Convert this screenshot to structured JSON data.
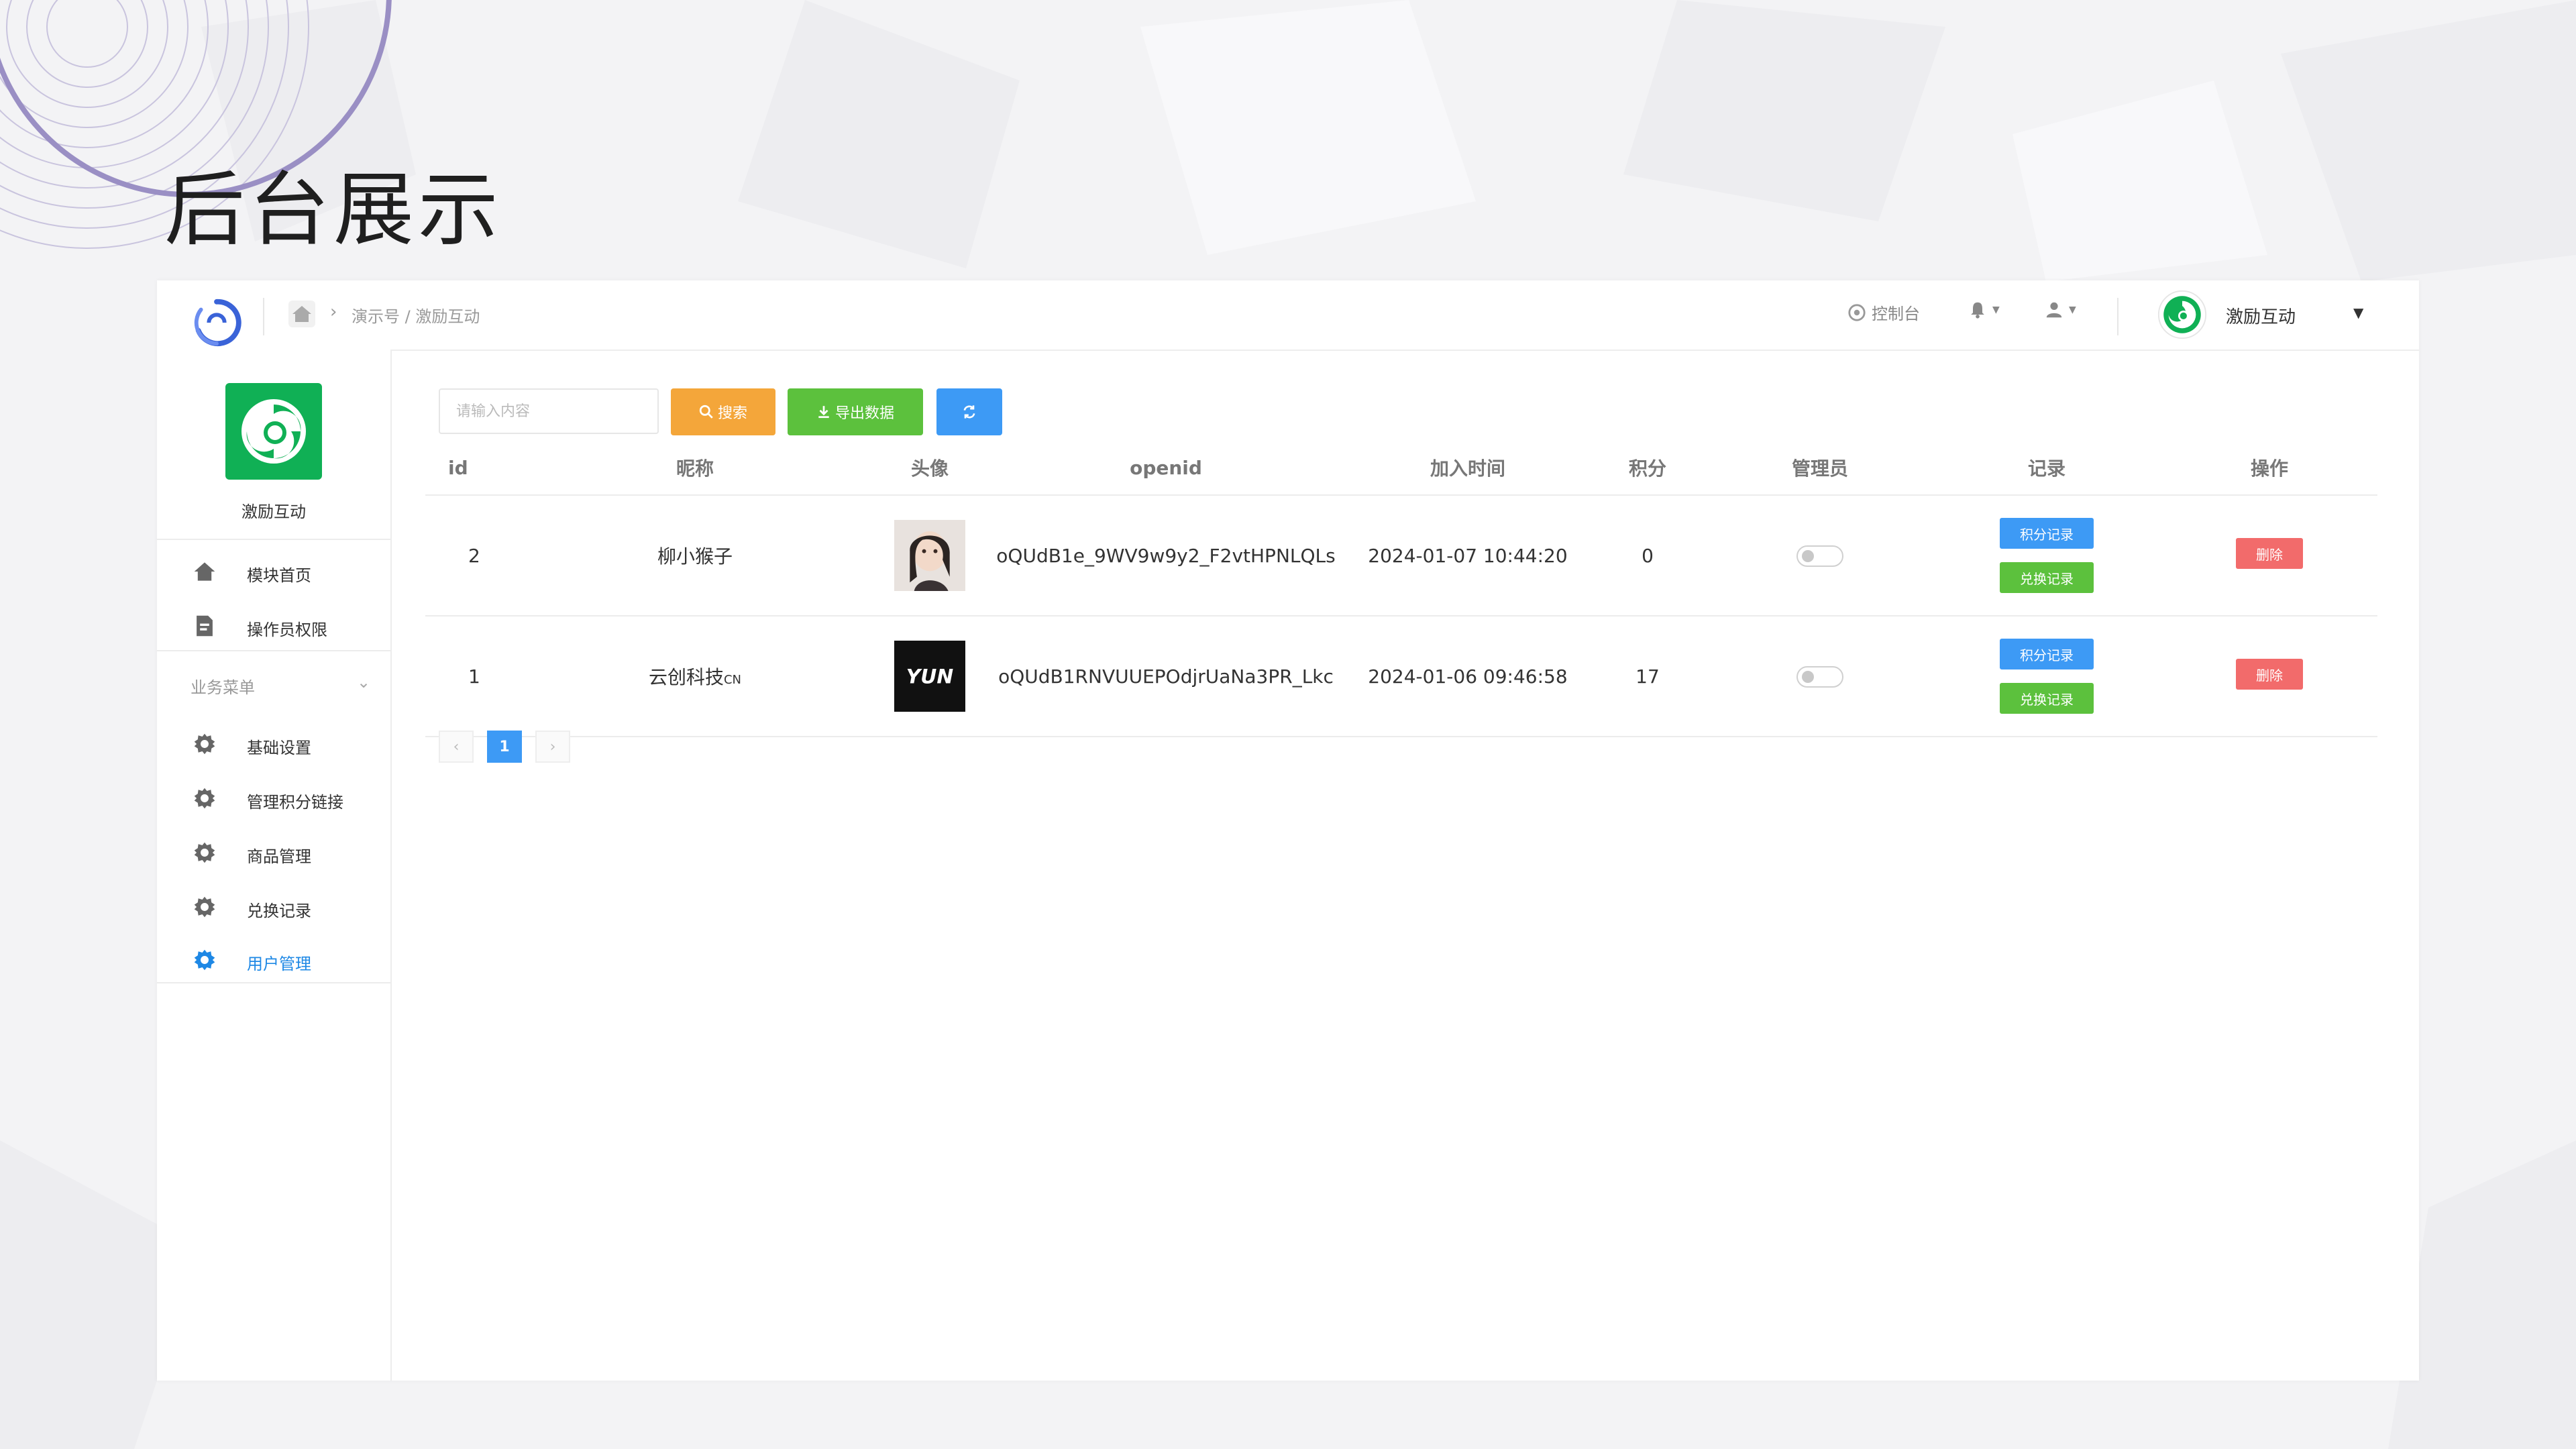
{
  "slide": {
    "title": "后台展示"
  },
  "topbar": {
    "breadcrumb": "演示号 / 激励互动",
    "console": "控制台",
    "account_name": "激励互动"
  },
  "sidebar": {
    "module_name": "激励互动",
    "top_items": [
      {
        "label": "模块首页",
        "icon": "home-icon"
      },
      {
        "label": "操作员权限",
        "icon": "document-edit-icon"
      }
    ],
    "group_title": "业务菜单",
    "group_items": [
      {
        "label": "基础设置",
        "icon": "gear-icon"
      },
      {
        "label": "管理积分链接",
        "icon": "gear-icon"
      },
      {
        "label": "商品管理",
        "icon": "gear-icon"
      },
      {
        "label": "兑换记录",
        "icon": "gear-icon"
      },
      {
        "label": "用户管理",
        "icon": "gear-icon",
        "active": true
      }
    ]
  },
  "toolbar": {
    "search_placeholder": "请输入内容",
    "search_label": "搜索",
    "export_label": "导出数据"
  },
  "table": {
    "headers": [
      "id",
      "昵称",
      "头像",
      "openid",
      "加入时间",
      "积分",
      "管理员",
      "记录",
      "操作"
    ],
    "rows": [
      {
        "id": "2",
        "nickname": "柳小猴子",
        "openid": "oQUdB1e_9WV9w9y2_F2vtHPNLQLs",
        "joined": "2024-01-07 10:44:20",
        "points": "0",
        "admin": false,
        "points_record": "积分记录",
        "redeem_record": "兑换记录",
        "delete": "删除"
      },
      {
        "id": "1",
        "nickname": "云创科技",
        "nickname_suffix": "CN",
        "openid": "oQUdB1RNVUUEPOdjrUaNa3PR_Lkc",
        "joined": "2024-01-06 09:46:58",
        "points": "17",
        "admin": false,
        "points_record": "积分记录",
        "redeem_record": "兑换记录",
        "delete": "删除",
        "avatar_text": "YUN"
      }
    ]
  },
  "pagination": {
    "prev": "‹",
    "current": "1",
    "next": "›"
  },
  "colors": {
    "accent_blue": "#3d9af5",
    "success_green": "#5cc13d",
    "warning_orange": "#f4a63a",
    "danger_red": "#f26b6b",
    "brand_green": "#10b055"
  }
}
